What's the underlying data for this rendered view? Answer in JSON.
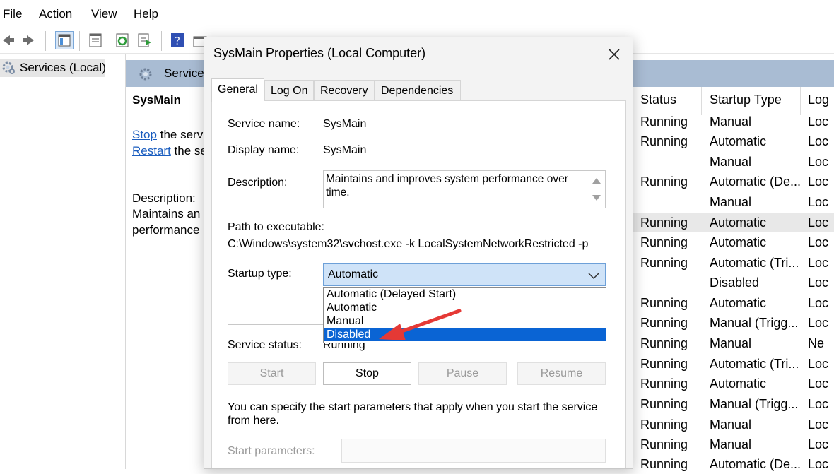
{
  "menu": [
    "File",
    "Action",
    "View",
    "Help"
  ],
  "tree": {
    "label": "Services (Local)"
  },
  "right_pane": {
    "header": "Services",
    "selected_name": "SysMain",
    "stop_link": "Stop",
    "stop_rest": "the serv",
    "restart_link": "Restart",
    "restart_rest": "the se",
    "desc_label": "Description:",
    "desc_line1": "Maintains an",
    "desc_line2": "performance"
  },
  "table": {
    "headers": {
      "status": "Status",
      "startup": "Startup Type",
      "logon": "Log"
    },
    "rows": [
      {
        "status": "Running",
        "startup": "Manual",
        "logon": "Loc"
      },
      {
        "status": "Running",
        "startup": "Automatic",
        "logon": "Loc"
      },
      {
        "status": "",
        "startup": "Manual",
        "logon": "Loc"
      },
      {
        "status": "Running",
        "startup": "Automatic (De...",
        "logon": "Loc"
      },
      {
        "status": "",
        "startup": "Manual",
        "logon": "Loc"
      },
      {
        "status": "Running",
        "startup": "Automatic",
        "logon": "Loc"
      },
      {
        "status": "Running",
        "startup": "Automatic",
        "logon": "Loc"
      },
      {
        "status": "Running",
        "startup": "Automatic (Tri...",
        "logon": "Loc"
      },
      {
        "status": "",
        "startup": "Disabled",
        "logon": "Loc"
      },
      {
        "status": "Running",
        "startup": "Automatic",
        "logon": "Loc"
      },
      {
        "status": "Running",
        "startup": "Manual (Trigg...",
        "logon": "Loc"
      },
      {
        "status": "Running",
        "startup": "Manual",
        "logon": "Ne"
      },
      {
        "status": "Running",
        "startup": "Automatic (Tri...",
        "logon": "Loc"
      },
      {
        "status": "Running",
        "startup": "Automatic",
        "logon": "Loc"
      },
      {
        "status": "Running",
        "startup": "Manual (Trigg...",
        "logon": "Loc"
      },
      {
        "status": "Running",
        "startup": "Manual",
        "logon": "Loc"
      },
      {
        "status": "Running",
        "startup": "Manual",
        "logon": "Loc"
      },
      {
        "status": "Running",
        "startup": "Automatic (De...",
        "logon": "Loc"
      }
    ]
  },
  "dialog": {
    "title": "SysMain Properties (Local Computer)",
    "tabs": [
      "General",
      "Log On",
      "Recovery",
      "Dependencies"
    ],
    "service_name_label": "Service name:",
    "service_name": "SysMain",
    "display_name_label": "Display name:",
    "display_name": "SysMain",
    "description_label": "Description:",
    "description": "Maintains and improves system performance over time.",
    "path_label": "Path to executable:",
    "path": "C:\\Windows\\system32\\svchost.exe -k LocalSystemNetworkRestricted -p",
    "startup_label": "Startup type:",
    "startup_value": "Automatic",
    "startup_options": [
      "Automatic (Delayed Start)",
      "Automatic",
      "Manual",
      "Disabled"
    ],
    "status_label": "Service status:",
    "status_value": "Running",
    "buttons": {
      "start": "Start",
      "stop": "Stop",
      "pause": "Pause",
      "resume": "Resume"
    },
    "hint": "You can specify the start parameters that apply when you start the service from here.",
    "params_label": "Start parameters:"
  },
  "colors": {
    "accent": "#0a64d4",
    "header_band": "#a9bcd3",
    "arrow": "#e53935"
  }
}
